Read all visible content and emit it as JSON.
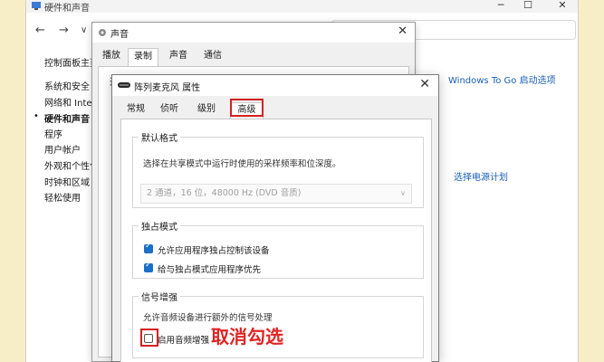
{
  "control_panel": {
    "title": "硬件和声音",
    "nav": {
      "back": "←",
      "forward": "→",
      "dropdown": "∨"
    },
    "window_buttons": {
      "minimize": "─",
      "maximize": "☐",
      "close": "✕"
    },
    "sidebar": [
      {
        "label": "控制面板主页"
      },
      {
        "label": "系统和安全"
      },
      {
        "label": "网络和 Inter"
      },
      {
        "label": "硬件和声音",
        "selected": true
      },
      {
        "label": "程序"
      },
      {
        "label": "用户帐户"
      },
      {
        "label": "外观和个性化"
      },
      {
        "label": "时钟和区域"
      },
      {
        "label": "轻松使用"
      }
    ],
    "bullet": "•",
    "links": {
      "windows_to_go": "Windows To Go 启动选项",
      "power_plan": "选择电源计划"
    }
  },
  "sound_dialog": {
    "title": "声音",
    "close": "✕",
    "tabs": [
      {
        "label": "播放"
      },
      {
        "label": "录制",
        "active": true
      },
      {
        "label": "声音"
      },
      {
        "label": "通信"
      }
    ],
    "fragment": "选"
  },
  "properties_dialog": {
    "title": "阵列麦克风 属性",
    "close": "✕",
    "tabs": [
      {
        "label": "常规"
      },
      {
        "label": "侦听"
      },
      {
        "label": "级别"
      },
      {
        "label": "高级",
        "active": true
      }
    ],
    "default_format": {
      "legend": "默认格式",
      "description": "选择在共享模式中运行时使用的采样频率和位深度。",
      "selected_format": "2 通道，16 位，48000 Hz (DVD 音质)",
      "chevron": "∨"
    },
    "exclusive_mode": {
      "legend": "独占模式",
      "options": [
        {
          "label": "允许应用程序独占控制该设备",
          "checked": true
        },
        {
          "label": "给与独占模式应用程序优先",
          "checked": true
        }
      ]
    },
    "signal_enhancement": {
      "legend": "信号增强",
      "description": "允许音频设备进行额外的信号处理",
      "option": {
        "label": "启用音频增强",
        "checked": false
      }
    }
  },
  "annotation": {
    "text": "取消勾选"
  },
  "colors": {
    "highlight": "#d42020",
    "checkbox_on": "#1a6fc7",
    "link": "#1a5fb4",
    "background": "#f7edc6"
  }
}
